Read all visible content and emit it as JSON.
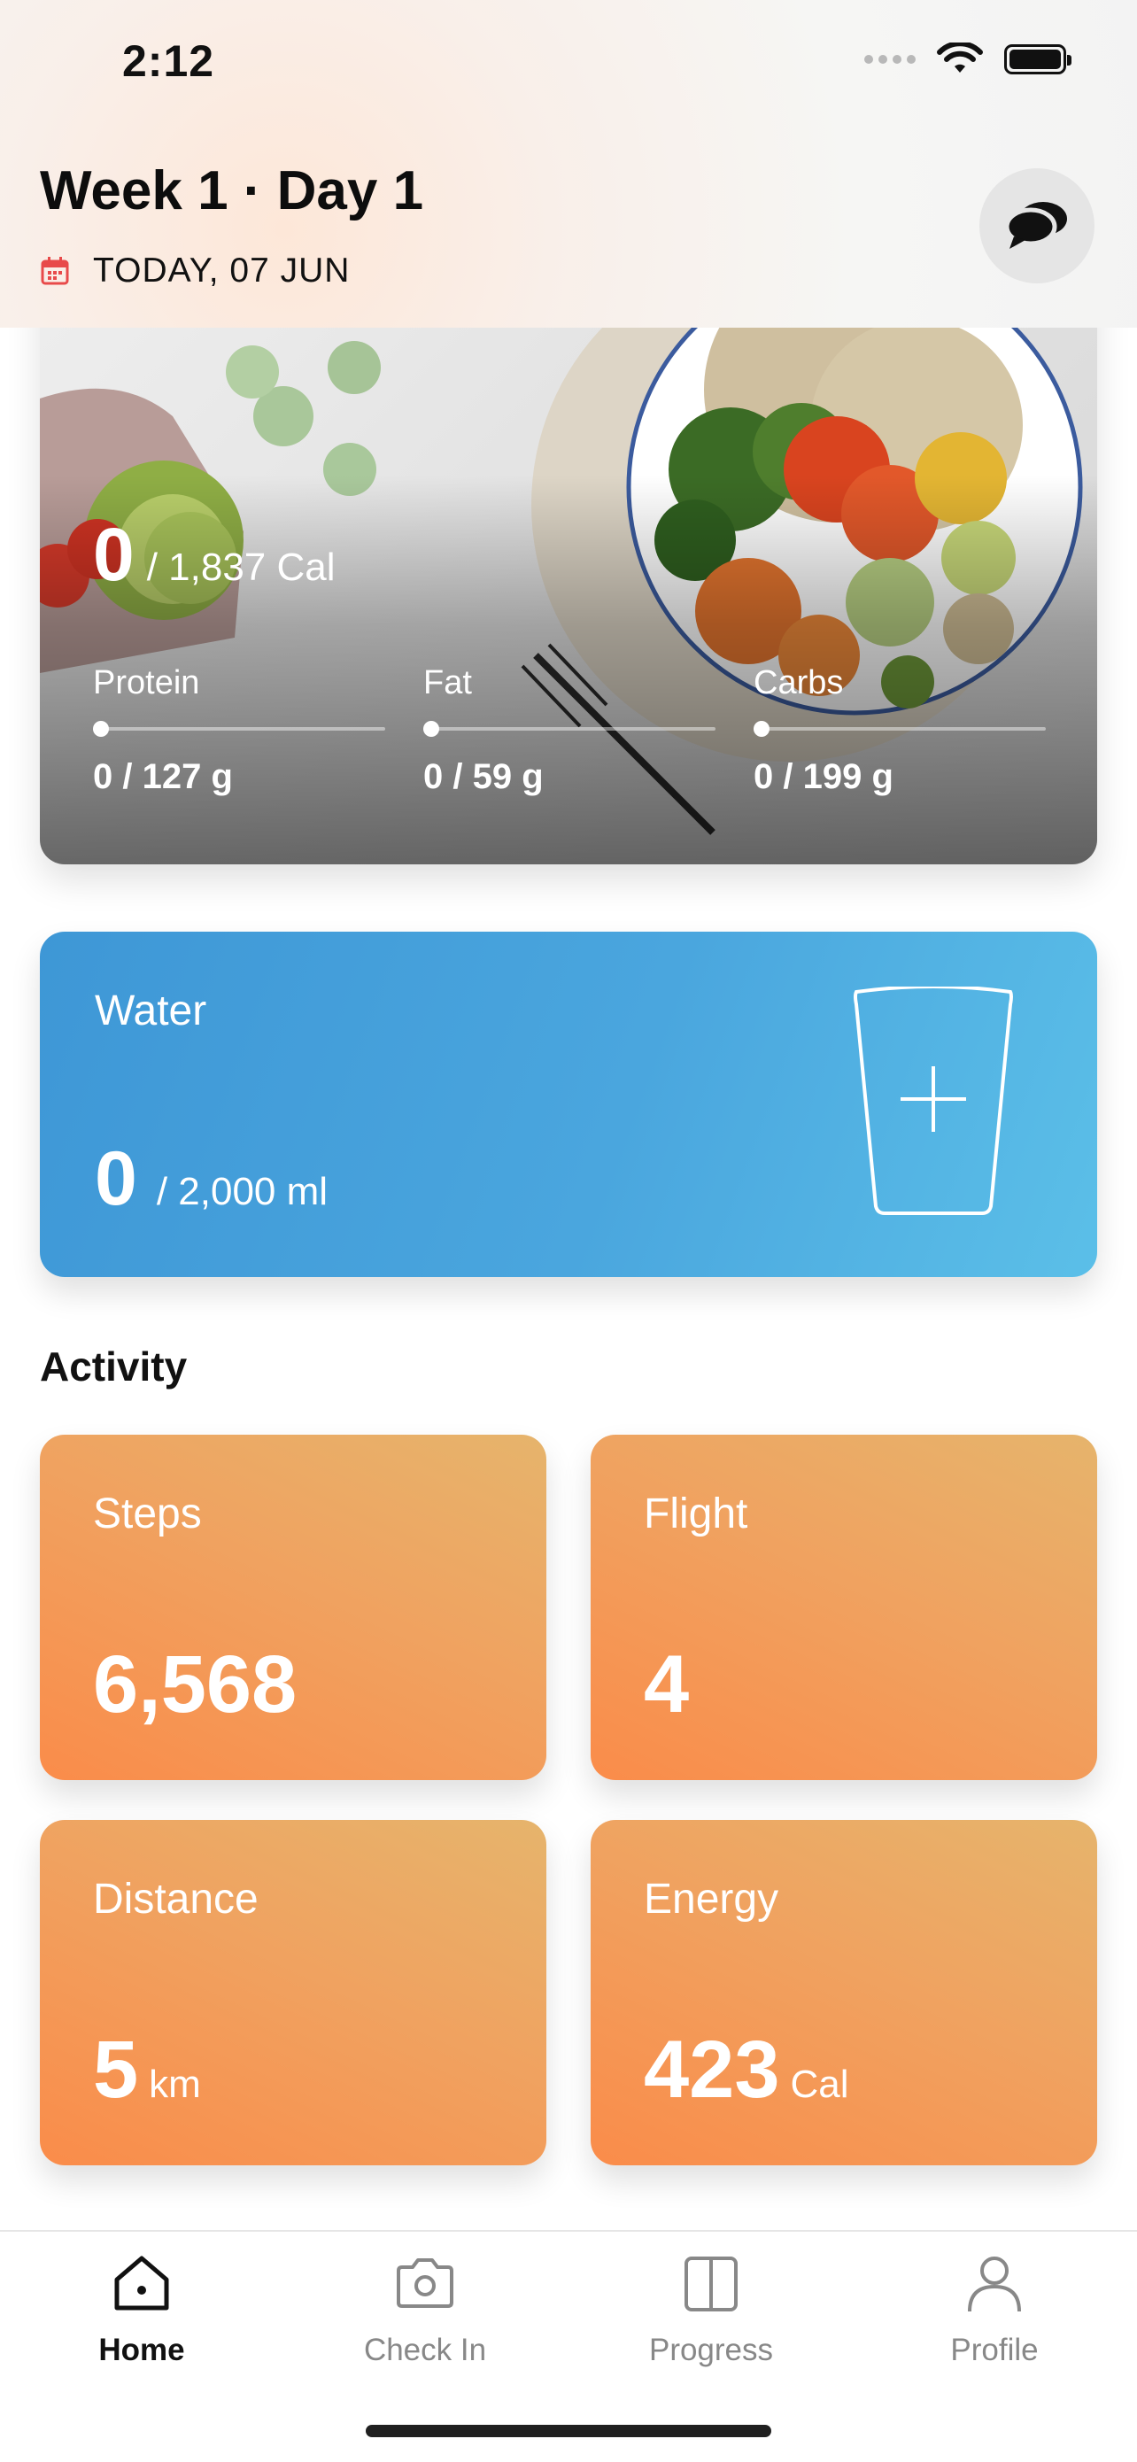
{
  "status_bar": {
    "time": "2:12"
  },
  "header": {
    "title": "Week 1 · Day 1",
    "date": "TODAY, 07 JUN"
  },
  "meal": {
    "consumed": "0",
    "goal": "/ 1,837 Cal",
    "macros": [
      {
        "label": "Protein",
        "value": "0 / 127 g",
        "progress": 0
      },
      {
        "label": "Fat",
        "value": "0 / 59 g",
        "progress": 0
      },
      {
        "label": "Carbs",
        "value": "0 / 199 g",
        "progress": 0
      }
    ]
  },
  "water": {
    "title": "Water",
    "amount": "0",
    "goal": "/  2,000 ml"
  },
  "activity": {
    "title": "Activity",
    "tiles": [
      {
        "label": "Steps",
        "value": "6,568",
        "unit": ""
      },
      {
        "label": "Flight",
        "value": "4",
        "unit": ""
      },
      {
        "label": "Distance",
        "value": "5",
        "unit": "km"
      },
      {
        "label": "Energy",
        "value": "423",
        "unit": "Cal"
      }
    ]
  },
  "tabs": [
    {
      "label": "Home",
      "icon": "home-icon",
      "active": true
    },
    {
      "label": "Check In",
      "icon": "camera-icon",
      "active": false
    },
    {
      "label": "Progress",
      "icon": "progress-icon",
      "active": false
    },
    {
      "label": "Profile",
      "icon": "profile-icon",
      "active": false
    }
  ],
  "colors": {
    "water_gradient_start": "#3e97d6",
    "water_gradient_end": "#5bbfe8",
    "activity_gradient_start": "#fa8c4a",
    "activity_gradient_end": "#e6b46c",
    "calendar_icon": "#e84a4a"
  }
}
